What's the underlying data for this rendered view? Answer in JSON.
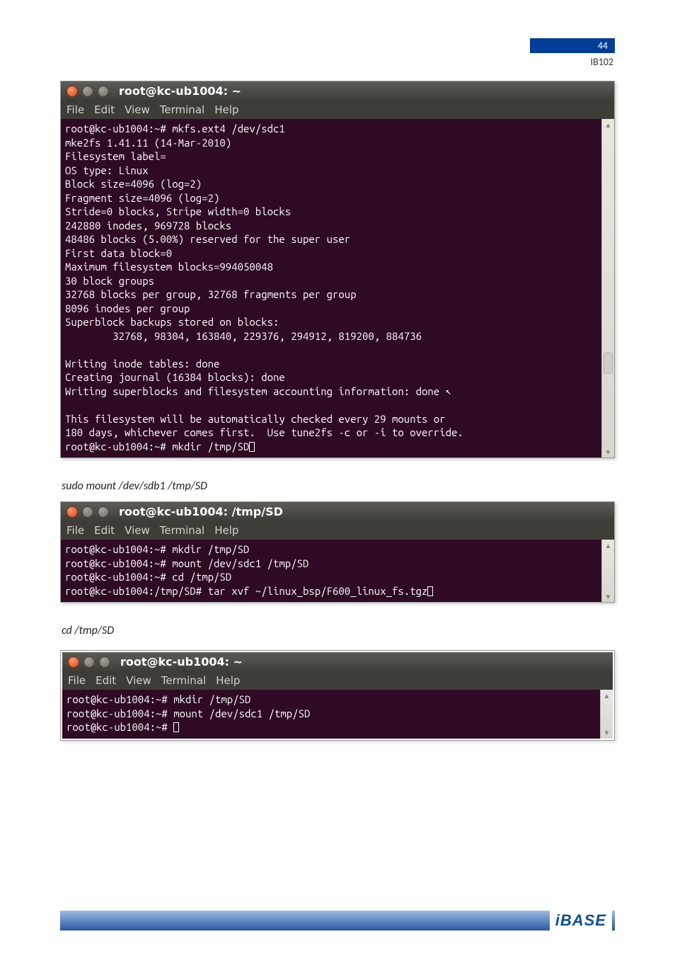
{
  "header": {
    "page_number": "44",
    "doc_code": "IB102"
  },
  "menus": {
    "file": "File",
    "edit": "Edit",
    "view": "View",
    "terminal": "Terminal",
    "help": "Help"
  },
  "terminal1": {
    "title": "root@kc-ub1004: ~",
    "lines": [
      "root@kc-ub1004:~# mkfs.ext4 /dev/sdc1",
      "mke2fs 1.41.11 (14-Mar-2010)",
      "Filesystem label=",
      "OS type: Linux",
      "Block size=4096 (log=2)",
      "Fragment size=4096 (log=2)",
      "Stride=0 blocks, Stripe width=0 blocks",
      "242880 inodes, 969728 blocks",
      "48486 blocks (5.00%) reserved for the super user",
      "First data block=0",
      "Maximum filesystem blocks=994050048",
      "30 block groups",
      "32768 blocks per group, 32768 fragments per group",
      "8096 inodes per group",
      "Superblock backups stored on blocks:",
      "        32768, 98304, 163840, 229376, 294912, 819200, 884736",
      "",
      "Writing inode tables: done",
      "Creating journal (16384 blocks): done",
      "Writing superblocks and filesystem accounting information: done ",
      "",
      "This filesystem will be automatically checked every 29 mounts or",
      "180 days, whichever comes first.  Use tune2fs -c or -i to override.",
      "root@kc-ub1004:~# mkdir /tmp/SD"
    ]
  },
  "caption1": "sudo mount /dev/sdb1 /tmp/SD",
  "terminal2": {
    "title": "root@kc-ub1004: /tmp/SD",
    "lines": [
      "root@kc-ub1004:~# mkdir /tmp/SD",
      "root@kc-ub1004:~# mount /dev/sdc1 /tmp/SD",
      "root@kc-ub1004:~# cd /tmp/SD",
      "root@kc-ub1004:/tmp/SD# tar xvf ~/linux_bsp/F600_linux_fs.tgz"
    ]
  },
  "caption2": "cd /tmp/SD",
  "terminal3": {
    "title": "root@kc-ub1004: ~",
    "lines": [
      "root@kc-ub1004:~# mkdir /tmp/SD",
      "root@kc-ub1004:~# mount /dev/sdc1 /tmp/SD",
      "root@kc-ub1004:~# "
    ]
  },
  "footer": {
    "logo": "iBASE"
  }
}
